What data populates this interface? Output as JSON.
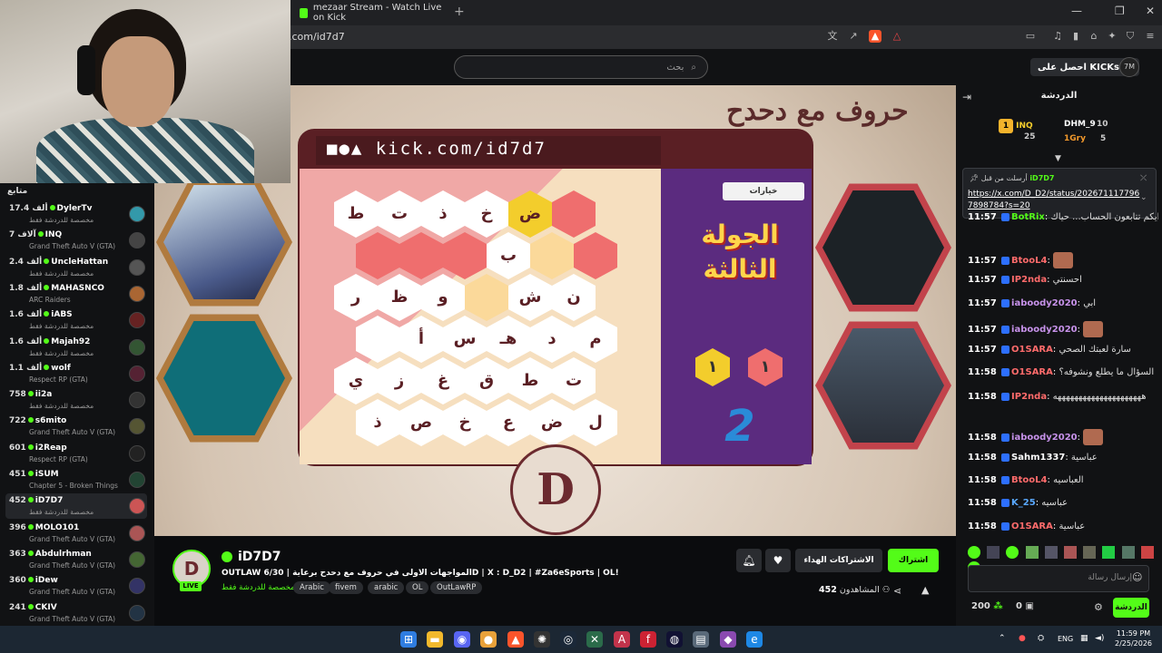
{
  "browser": {
    "tab_title": "mezaar Stream - Watch Live on Kick",
    "new_tab": "+",
    "url": ".com/id7d7",
    "controls": [
      "—",
      "❐",
      "✕"
    ]
  },
  "header": {
    "search_placeholder": "بحث",
    "get_kick": "احصل على KICKs",
    "user_initials": "7M"
  },
  "sidebar": {
    "title": "متابع",
    "channels": [
      {
        "count": "17.4 ألف",
        "name": "DylerTv",
        "category": "مخصصة للدردشة فقط"
      },
      {
        "count": "7 آلاف",
        "name": "INQ",
        "category": "Grand Theft Auto V (GTA)"
      },
      {
        "count": "2.4 ألف",
        "name": "UncleHattan",
        "category": "مخصصة للدردشة فقط"
      },
      {
        "count": "1.8 ألف",
        "name": "MAHASNCO",
        "category": "ARC Raiders"
      },
      {
        "count": "1.6 ألف",
        "name": "iABS",
        "category": "مخصصة للدردشة فقط"
      },
      {
        "count": "1.6 ألف",
        "name": "Majah92",
        "category": "مخصصة للدردشة فقط"
      },
      {
        "count": "1.1 ألف",
        "name": "wolf",
        "category": "Respect RP (GTA)"
      },
      {
        "count": "758",
        "name": "ii2a",
        "category": "مخصصة للدردشة فقط"
      },
      {
        "count": "722",
        "name": "s6mito",
        "category": "Grand Theft Auto V (GTA)"
      },
      {
        "count": "601",
        "name": "i2Reap",
        "category": "Respect RP (GTA)"
      },
      {
        "count": "451",
        "name": "iSUM",
        "category": "Chapter 5 - Broken Things"
      },
      {
        "count": "452",
        "name": "iD7D7",
        "category": "مخصصة للدردشة فقط"
      },
      {
        "count": "396",
        "name": "MOLO101",
        "category": "Grand Theft Auto V (GTA)"
      },
      {
        "count": "363",
        "name": "Abdulrhman",
        "category": "Grand Theft Auto V (GTA)"
      },
      {
        "count": "360",
        "name": "iDew",
        "category": "Grand Theft Auto V (GTA)"
      },
      {
        "count": "241",
        "name": "CKIV",
        "category": "Grand Theft Auto V (GTA)"
      }
    ]
  },
  "stream": {
    "game_title": "حروف مع دحدح",
    "board_url": "■●▲ kick.com/id7d7",
    "options_label": "خيارات",
    "round_text": "الجولة الثالثة",
    "score_left": "١",
    "score_right": "١",
    "logo_letter": "D",
    "hex_rows": [
      [
        "ط",
        "ت",
        "ذ",
        "خ",
        "ض",
        ""
      ],
      [
        "",
        "",
        "",
        "ب",
        "",
        ""
      ],
      [
        "ر",
        "ظ",
        "و",
        "",
        "ش",
        "ن"
      ],
      [
        "",
        "أ",
        "س",
        "هـ",
        "د",
        "م"
      ],
      [
        "ي",
        "ز",
        "غ",
        "ق",
        "ط",
        "ت"
      ],
      [
        "ذ",
        "ص",
        "خ",
        "ع",
        "ض",
        "ل"
      ]
    ],
    "hex_colors": [
      [
        "w",
        "w",
        "w",
        "w",
        "g",
        "r"
      ],
      [
        "r",
        "r",
        "r",
        "w",
        "e",
        "r"
      ],
      [
        "w",
        "w",
        "w",
        "e",
        "w",
        "w"
      ],
      [
        "w",
        "w",
        "w",
        "w",
        "w",
        "w"
      ],
      [
        "w",
        "w",
        "w",
        "w",
        "w",
        "w"
      ],
      [
        "w",
        "w",
        "w",
        "w",
        "w",
        "w"
      ]
    ]
  },
  "chat": {
    "title": "الدردشة",
    "leaders": {
      "first": "INQ",
      "first_score": "25",
      "second": "DHM_9",
      "second_score": "10",
      "third": "1Gry",
      "third_score": "5"
    },
    "pinned_by": "أرسلت من قبل",
    "pinned_user": "iD7D7",
    "pinned_link": "https://x.com/D_D2/status/2026711177967898784?s=20",
    "messages": [
      {
        "time": "11:57",
        "user": "BotRix",
        "color": "#53fc18",
        "text": "شرايكم تتابعون الحساب... حياك"
      },
      {
        "time": "11:57",
        "user": "BtooL4",
        "color": "#ff6b6b",
        "text": ""
      },
      {
        "time": "11:57",
        "user": "IP2nda",
        "color": "#ff6b6b",
        "text": "احسنتي"
      },
      {
        "time": "11:57",
        "user": "iaboody2020",
        "color": "#c792ea",
        "text": "ابي"
      },
      {
        "time": "11:57",
        "user": "iaboody2020",
        "color": "#c792ea",
        "text": ""
      },
      {
        "time": "11:57",
        "user": "O1SARA",
        "color": "#ff6b6b",
        "text": "سارة لعبتك الصحي"
      },
      {
        "time": "11:58",
        "user": "O1SARA",
        "color": "#ff6b6b",
        "text": "السؤال ما يطلع ونشوفه؟"
      },
      {
        "time": "11:58",
        "user": "IP2nda",
        "color": "#ff6b6b",
        "text": "هههههههههههههههههههههه"
      },
      {
        "time": "11:58",
        "user": "iaboody2020",
        "color": "#c792ea",
        "text": ""
      },
      {
        "time": "11:58",
        "user": "Sahm1337",
        "color": "#ffffff",
        "text": "عباسية"
      },
      {
        "time": "11:58",
        "user": "BtooL4",
        "color": "#ff6b6b",
        "text": "العباسيه"
      },
      {
        "time": "11:58",
        "user": "K_25",
        "color": "#5aa9ff",
        "text": "عباسيه"
      },
      {
        "time": "11:58",
        "user": "O1SARA",
        "color": "#ff6b6b",
        "text": "عباسية"
      }
    ],
    "input_placeholder": "إرسال رسالة",
    "send_label": "الدردشة",
    "points": "200",
    "zero": "0"
  },
  "info": {
    "channel_name": "iD7D7",
    "live": "LIVE",
    "title": "OUTLAW المواجهات الاولى في حروف مع دحدح برعاية | 6/30D | X : D_D2 | #Za6eSports | OL!",
    "category": "مخصصة للدردشة فقط",
    "tags": [
      "Arabic",
      "fivem",
      "arabic",
      "OL",
      "OutLawRP"
    ],
    "subscribe": "اشتراك",
    "gift_subs": "الاشتراكات الهداء",
    "viewers_label": "المشاهدون",
    "viewers": "452"
  },
  "taskbar": {
    "lang": "ENG",
    "time": "11:59 PM",
    "date": "2/25/2026"
  },
  "colors": {
    "accent": "#53fc18",
    "board": "#5a1f24",
    "panel": "#5b2b7f"
  }
}
